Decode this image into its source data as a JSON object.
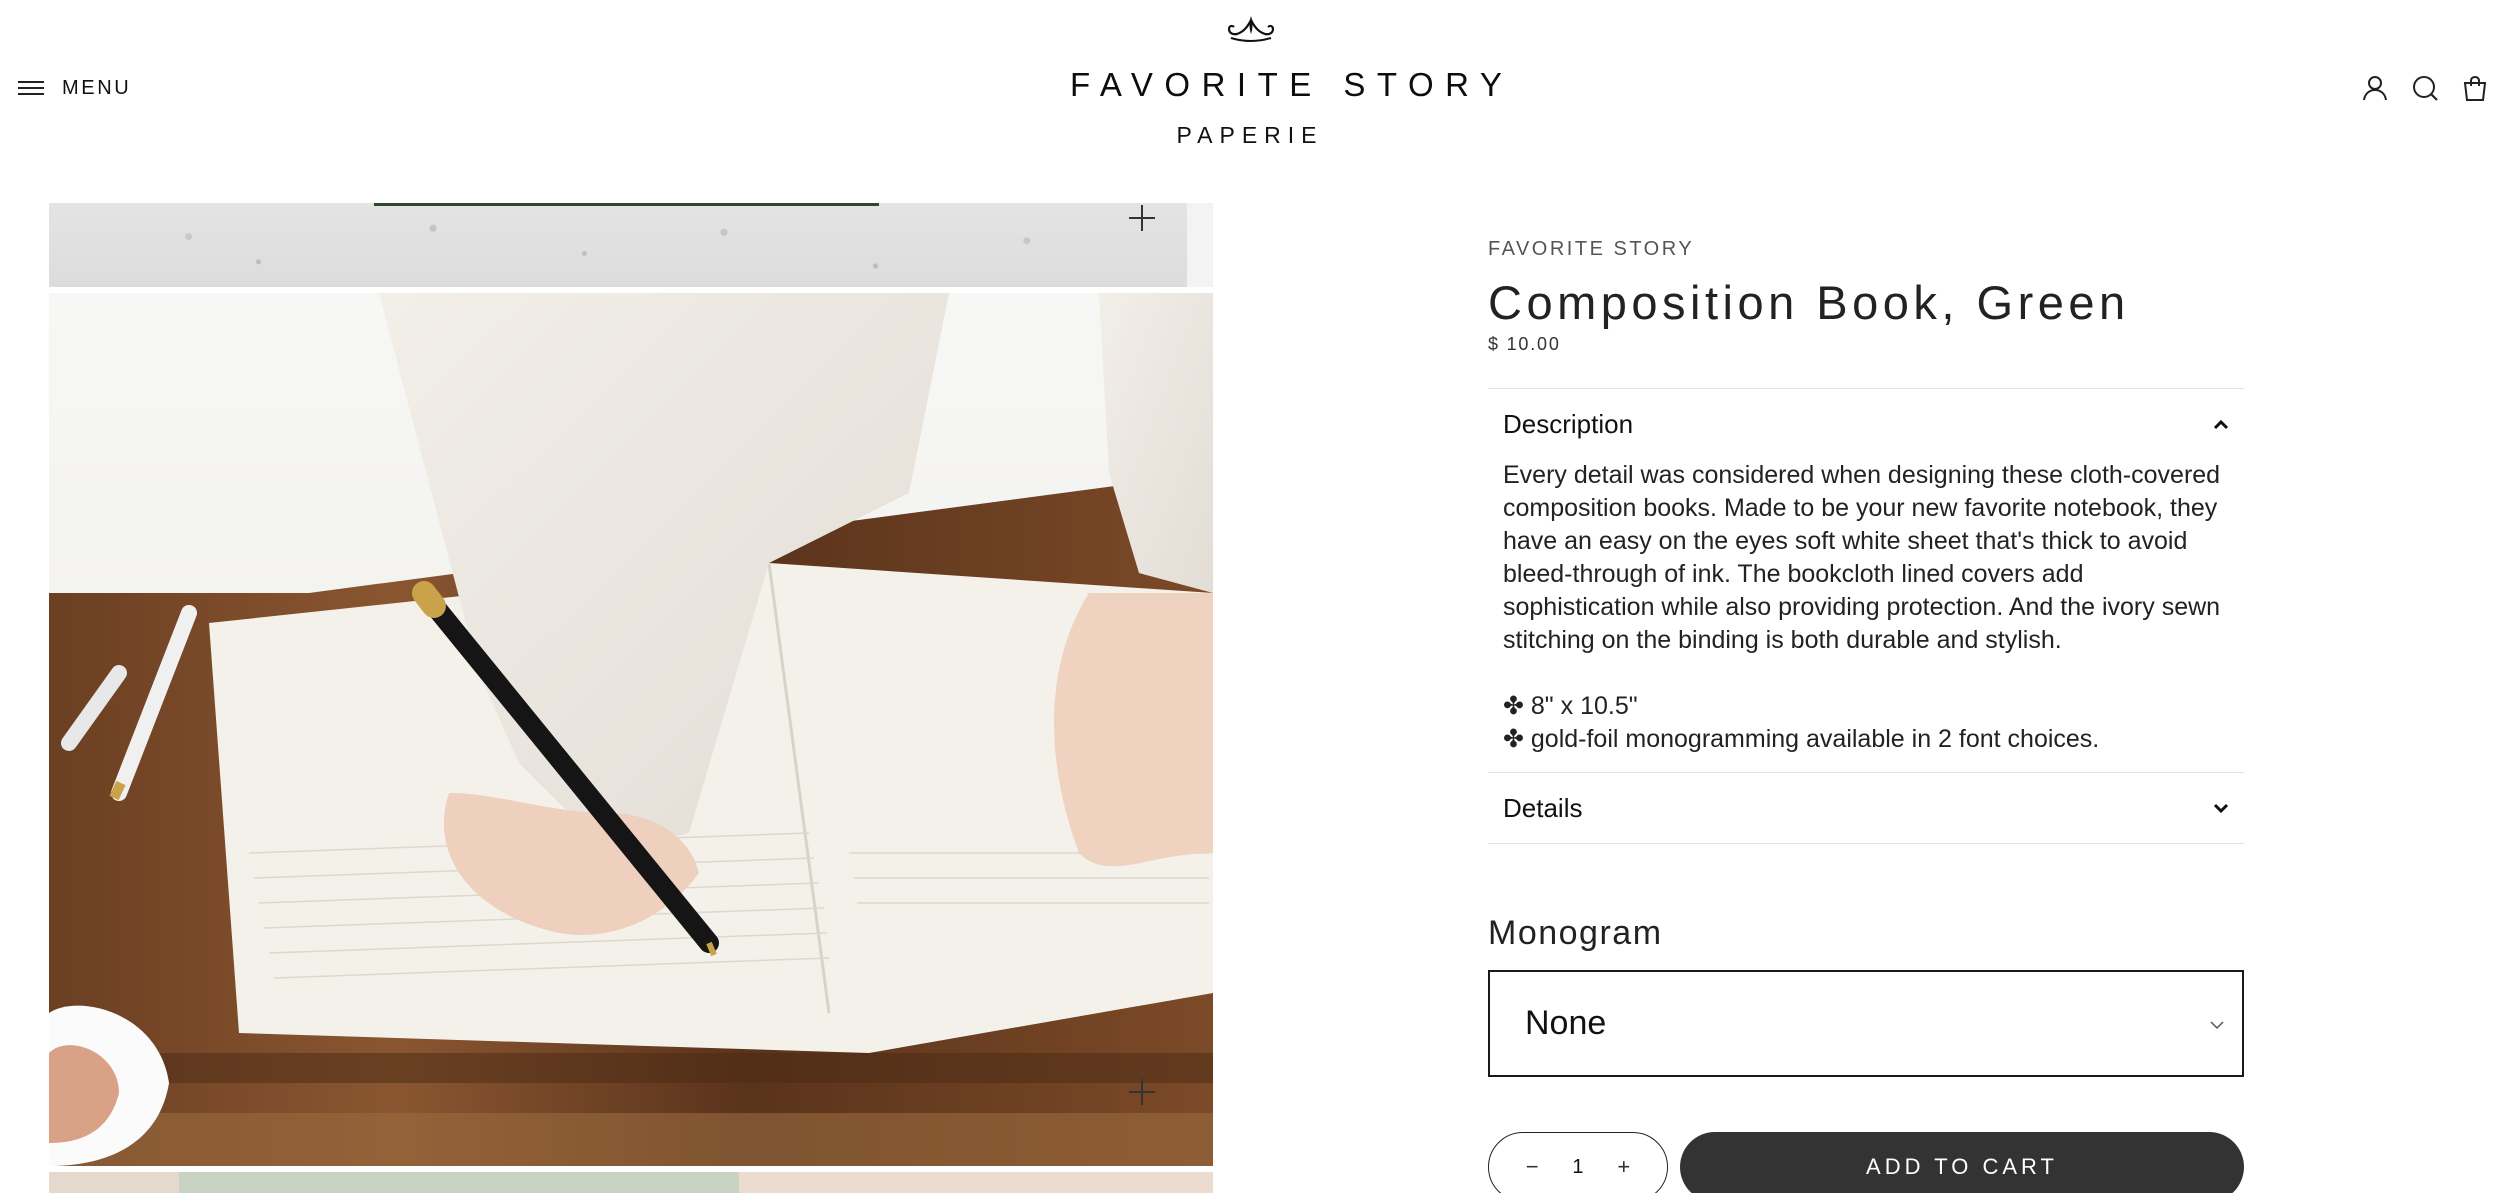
{
  "header": {
    "menu_label": "MENU",
    "logo_title": "FAVORITE STORY",
    "logo_subtitle": "PAPERIE",
    "icons": [
      "account-icon",
      "search-icon",
      "cart-icon"
    ]
  },
  "product": {
    "vendor": "FAVORITE STORY",
    "title": "Composition Book, Green",
    "price": "$ 10.00",
    "description": {
      "heading": "Description",
      "text": "Every detail was considered when designing these cloth-covered composition books. Made to be your new favorite notebook, they have an easy on the eyes soft white sheet that's thick to avoid bleed-through of ink. The bookcloth lined covers add sophistication while also providing protection. And the ivory sewn stitching on the binding is both durable and stylish.",
      "bullets": [
        "✤ 8\" x 10.5\"",
        "✤ gold-foil monogramming available in 2 font choices."
      ]
    },
    "details_heading": "Details",
    "monogram": {
      "label": "Monogram",
      "selected": "None"
    },
    "quantity": {
      "value": "1",
      "minus": "−",
      "plus": "+"
    },
    "add_to_cart": "ADD TO CART"
  },
  "colors": {
    "text": "#1c1c1c",
    "button": "#333333",
    "border": "#e3e3e3",
    "cover_green": "#2e4a2c"
  }
}
